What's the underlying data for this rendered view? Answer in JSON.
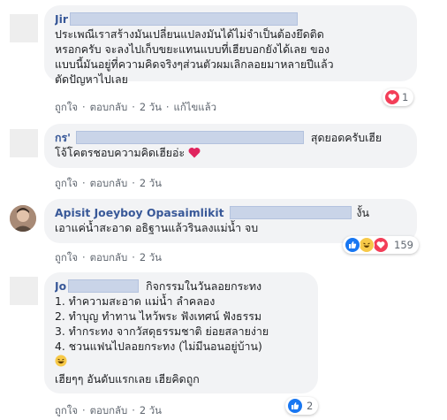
{
  "comments": [
    {
      "author_visible": "Jir",
      "lines": [
        "ประเพณีเราสร้างมันเปลี่ยนแปลงมันได้ไม่จำเป็นต้องยึดติด",
        "หรอกครับ จะลงไปเก็บขยะแทนแบบที่เฮียบอกยังได้เลย ของ",
        "แบบนี้มันอยู่ที่ความคิดจริงๆส่วนตัวผมเลิกลอยมาหลายปีแล้ว",
        "ตัดปัญหาไปเลย"
      ],
      "reactions": {
        "count": "1",
        "icons": [
          "heart"
        ]
      },
      "actions": [
        "ถูกใจ",
        "ตอบกลับ",
        "2 วัน",
        "แก้ไขแล้ว"
      ]
    },
    {
      "author_visible": "กร'",
      "line1_tail": "สุดยอดครับเฮีย",
      "line2": "โจ้โคตรชอบความคิดเฮียอ่ะ",
      "actions": [
        "ถูกใจ",
        "ตอบกลับ",
        "2 วัน"
      ]
    },
    {
      "author": "Apisit Joeyboy Opasaimlikit",
      "line1_tail": "งั้น",
      "line2": "เอาแค่น้ำสะอาด อธิฐานแล้วรินลงแม่น้ำ จบ",
      "reactions": {
        "count": "159",
        "icons": [
          "like",
          "haha",
          "love"
        ]
      },
      "actions": [
        "ถูกใจ",
        "ตอบกลับ",
        "2 วัน"
      ]
    },
    {
      "author_visible": "Jo",
      "line1_tail": "กิจกรรมในวันลอยกระทง",
      "lines": [
        "1. ทำความสะอาด แม่น้ำ ลำคลอง",
        "2. ทำบุญ ทำทาน ไหว้พระ ฟังเทศน์ ฟังธรรม",
        "3. ทำกระทง จากวัสดุธรรมชาติ ย่อยสลายง่าย",
        "4. ชวนแฟนไปลอยกระทง (ไม่มีนอนอยู่บ้าน)"
      ],
      "closing": "เฮียๆๆ อันดับแรกเลย เฮียคิดถูก",
      "reactions": {
        "count": "2",
        "icons": [
          "like"
        ]
      },
      "actions": [
        "ถูกใจ",
        "ตอบกลับ",
        "2 วัน"
      ]
    }
  ],
  "colors": {
    "author": "#385898",
    "bubble": "#f2f3f5",
    "like": "#1877f2",
    "love": "#f33e58",
    "haha": "#f7c948"
  }
}
